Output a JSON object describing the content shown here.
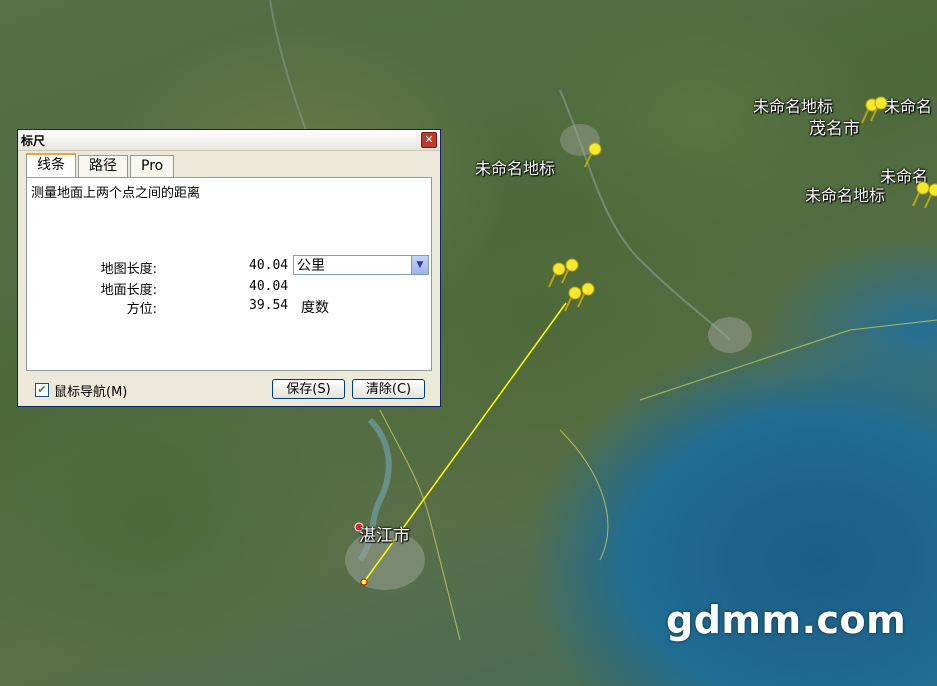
{
  "map": {
    "labels": [
      {
        "text": "未命名地标"
      },
      {
        "text": "未命名地标"
      },
      {
        "text": "未命名地标"
      },
      {
        "text": "未命名"
      },
      {
        "text": "未命名"
      },
      {
        "text": "茂名市"
      },
      {
        "text": "湛江市"
      }
    ],
    "watermark": "gdmm.com",
    "measure_line_color": "#ffff00",
    "pin_color": "#f6e82c"
  },
  "dialog": {
    "title": "标尺",
    "tabs": [
      {
        "label": "线条"
      },
      {
        "label": "路径"
      },
      {
        "label": "Pro"
      }
    ],
    "description": "测量地面上两个点之间的距离",
    "map_length": {
      "label": "地图长度:",
      "value": "40.04"
    },
    "ground_length": {
      "label": "地面长度:",
      "value": "40.04"
    },
    "heading": {
      "label": "方位:",
      "value": "39.54",
      "unit": "度数"
    },
    "unit_select": {
      "selected": "公里"
    },
    "mouse_nav": {
      "label": "鼠标导航(M)",
      "checked": true
    },
    "save_label": "保存(S)",
    "clear_label": "清除(C)"
  }
}
